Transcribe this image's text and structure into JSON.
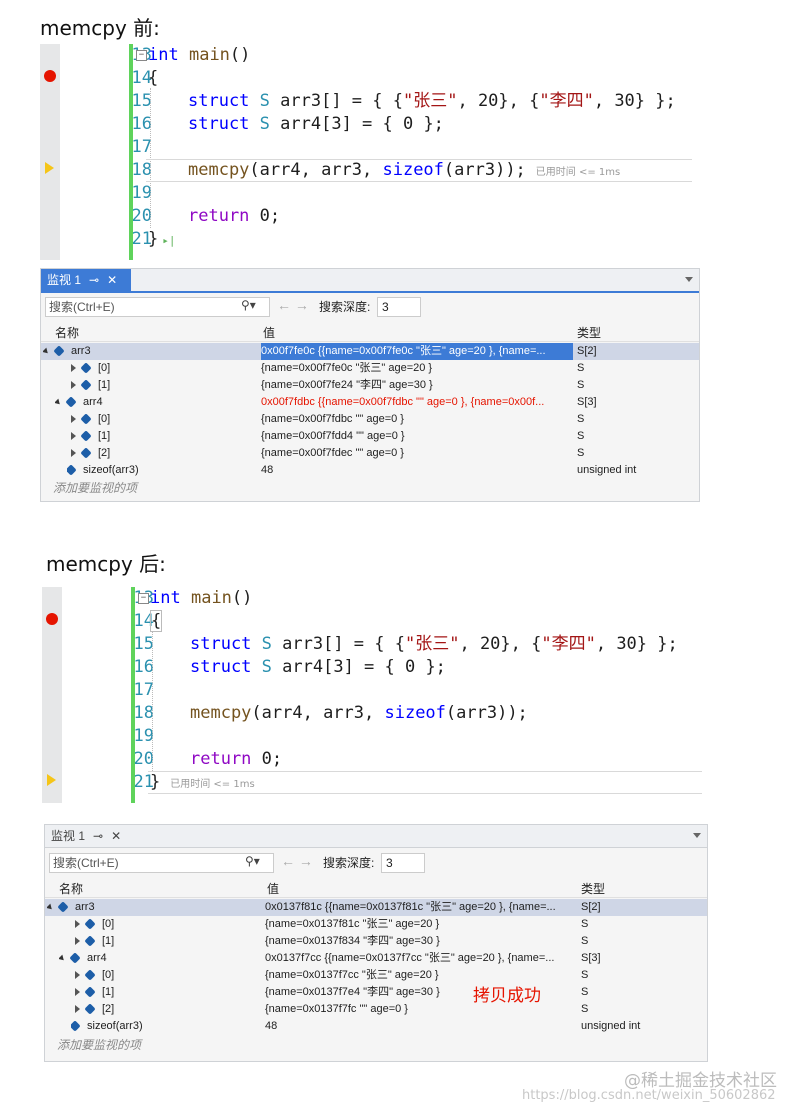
{
  "before": {
    "title": "memcpy 前:",
    "lines": [
      "13",
      "14",
      "15",
      "16",
      "17",
      "18",
      "19",
      "20",
      "21"
    ],
    "elapsed": "已用时间 <= 1ms",
    "watch": {
      "tab": "监视 1",
      "pin": "⊸",
      "close": "✕",
      "search_placeholder": "搜索(Ctrl+E)",
      "depth_label": "搜索深度:",
      "depth_value": "3",
      "headers": {
        "name": "名称",
        "value": "值",
        "type": "类型"
      },
      "rows": [
        {
          "name": "arr3",
          "value": "0x00f7fe0c {{name=0x00f7fe0c \"张三\" age=20 }, {name=...",
          "type": "S[2]"
        },
        {
          "name": "[0]",
          "value": "{name=0x00f7fe0c \"张三\" age=20 }",
          "type": "S"
        },
        {
          "name": "[1]",
          "value": "{name=0x00f7fe24 \"李四\" age=30 }",
          "type": "S"
        },
        {
          "name": "arr4",
          "value": "0x00f7fdbc {{name=0x00f7fdbc \"\" age=0 }, {name=0x00f...",
          "type": "S[3]"
        },
        {
          "name": "[0]",
          "value": "{name=0x00f7fdbc \"\" age=0 }",
          "type": "S"
        },
        {
          "name": "[1]",
          "value": "{name=0x00f7fdd4 \"\" age=0 }",
          "type": "S"
        },
        {
          "name": "[2]",
          "value": "{name=0x00f7fdec \"\" age=0 }",
          "type": "S"
        },
        {
          "name": "sizeof(arr3)",
          "value": "48",
          "type": "unsigned int"
        }
      ],
      "add_tip": "添加要监视的项"
    }
  },
  "after": {
    "title": "memcpy 后:",
    "lines": [
      "13",
      "14",
      "15",
      "16",
      "17",
      "18",
      "19",
      "20",
      "21"
    ],
    "elapsed": "已用时间 <= 1ms",
    "watch": {
      "tab": "监视 1",
      "pin": "⊸",
      "close": "✕",
      "search_placeholder": "搜索(Ctrl+E)",
      "depth_label": "搜索深度:",
      "depth_value": "3",
      "headers": {
        "name": "名称",
        "value": "值",
        "type": "类型"
      },
      "rows": [
        {
          "name": "arr3",
          "value": "0x0137f81c {{name=0x0137f81c \"张三\" age=20 }, {name=...",
          "type": "S[2]"
        },
        {
          "name": "[0]",
          "value": "{name=0x0137f81c \"张三\" age=20 }",
          "type": "S"
        },
        {
          "name": "[1]",
          "value": "{name=0x0137f834 \"李四\" age=30 }",
          "type": "S"
        },
        {
          "name": "arr4",
          "value": "0x0137f7cc {{name=0x0137f7cc \"张三\" age=20 }, {name=...",
          "type": "S[3]"
        },
        {
          "name": "[0]",
          "value": "{name=0x0137f7cc \"张三\" age=20 }",
          "type": "S"
        },
        {
          "name": "[1]",
          "value": "{name=0x0137f7e4 \"李四\" age=30 }",
          "type": "S"
        },
        {
          "name": "[2]",
          "value": "{name=0x0137f7fc \"\" age=0 }",
          "type": "S"
        },
        {
          "name": "sizeof(arr3)",
          "value": "48",
          "type": "unsigned int"
        }
      ],
      "add_tip": "添加要监视的项"
    },
    "note": "拷贝成功"
  },
  "code": {
    "kw_int": "int",
    "main": "main",
    "open_paren": "()",
    "brace_open": "{",
    "brace_close": "}",
    "kw_struct": "struct",
    "type_S": "S",
    "l15_rest": " arr3[] = { {",
    "str_zhang": "\"张三\"",
    "l15_mid": ", 20}, {",
    "str_li": "\"李四\"",
    "l15_end": ", 30} };",
    "l16_rest": " arr4[3] = { 0 };",
    "memcpy": "memcpy",
    "l18_a": "(arr4, arr3, ",
    "sizeof": "sizeof",
    "l18_b": "(arr3));",
    "kw_return": "return",
    "ret_rest": " 0;"
  },
  "watermark": {
    "site": "@稀土掘金技术社区",
    "url": "https://blog.csdn.net/weixin_50602862"
  },
  "colors": {
    "keyword": "#0000ff",
    "type": "#2b91af",
    "string": "#a31515",
    "accent": "#3d7bd6",
    "breakpoint": "#e51400",
    "note": "#e51400"
  }
}
